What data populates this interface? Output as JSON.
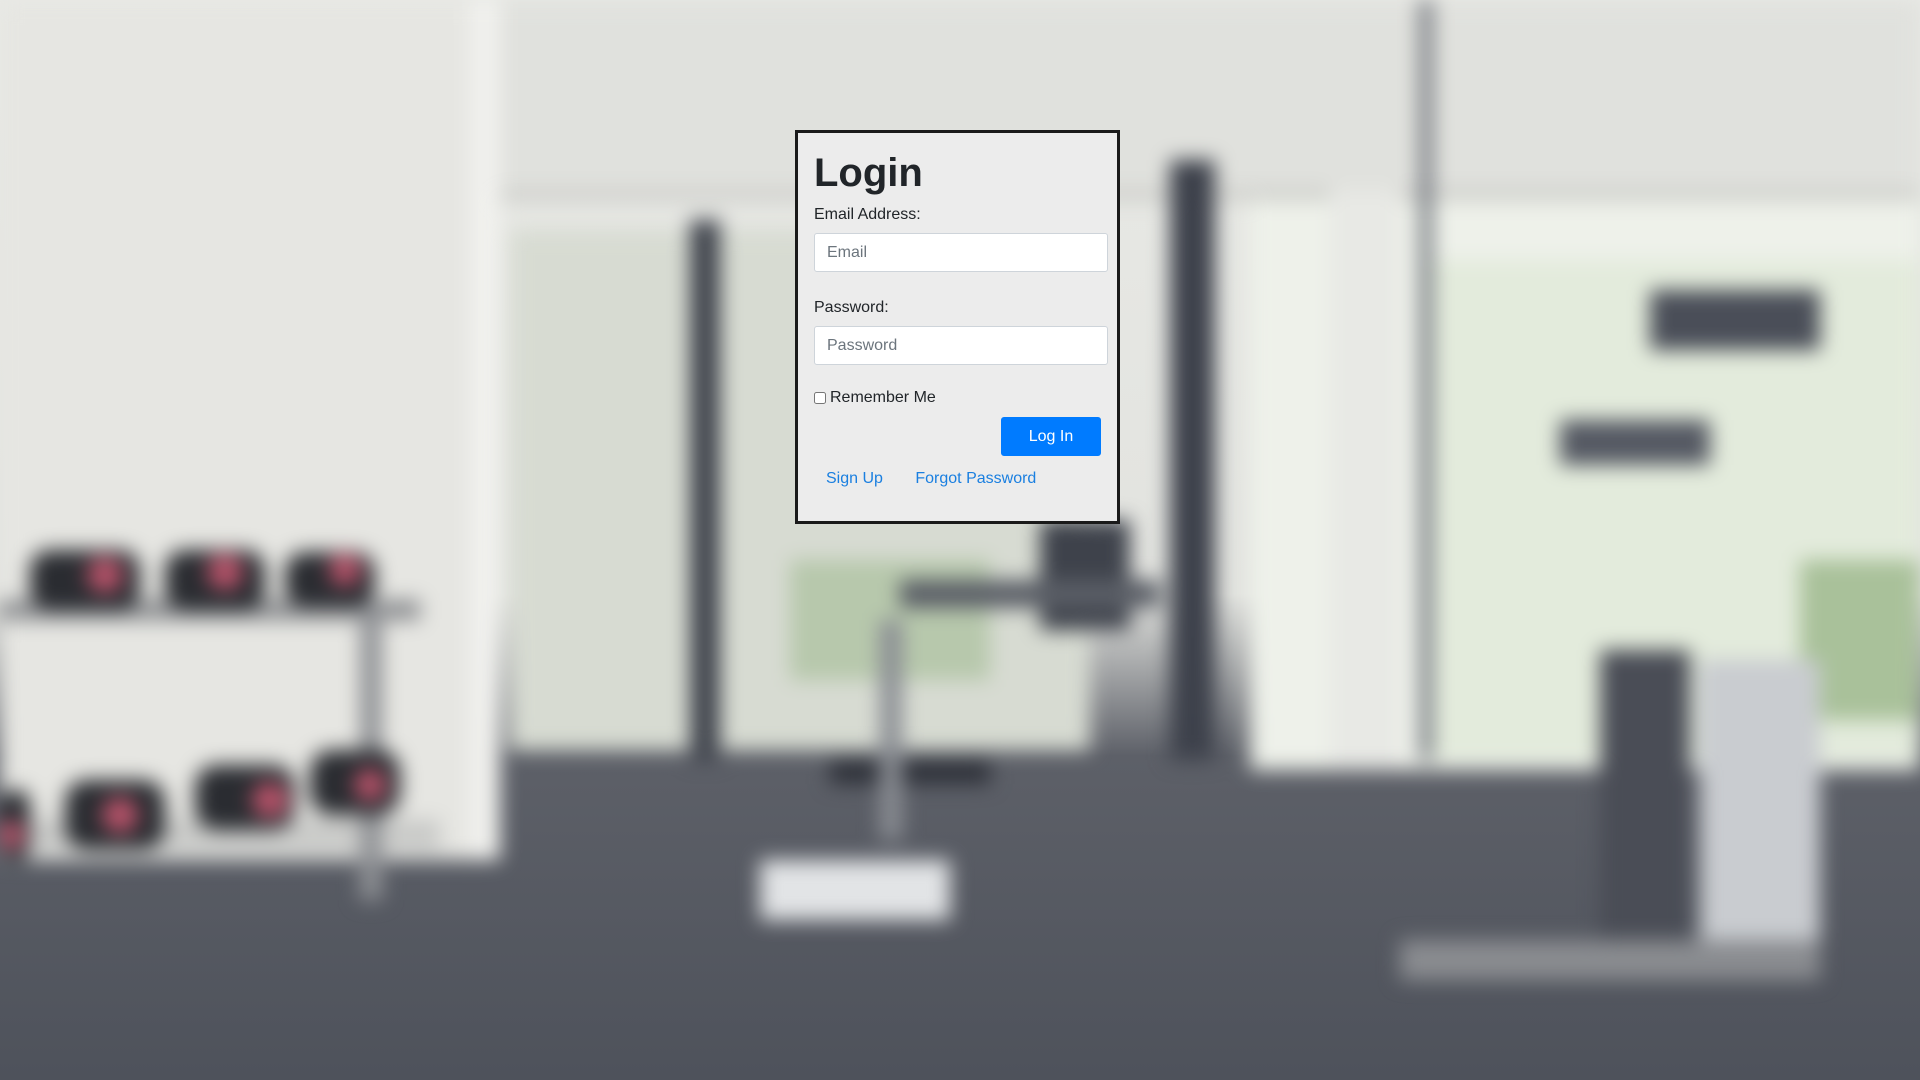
{
  "login": {
    "title": "Login",
    "email_label": "Email Address:",
    "email_value": "",
    "email_placeholder": "Email",
    "password_label": "Password:",
    "password_value": "",
    "password_placeholder": "Password",
    "remember_label": "Remember Me",
    "remember_checked": false,
    "login_button": "Log In",
    "signup_link": "Sign Up",
    "forgot_link": "Forgot Password"
  },
  "colors": {
    "primary": "#007bff",
    "link": "#1a7fe0",
    "card_background": "#ececec",
    "card_border": "#1a1a1a"
  }
}
